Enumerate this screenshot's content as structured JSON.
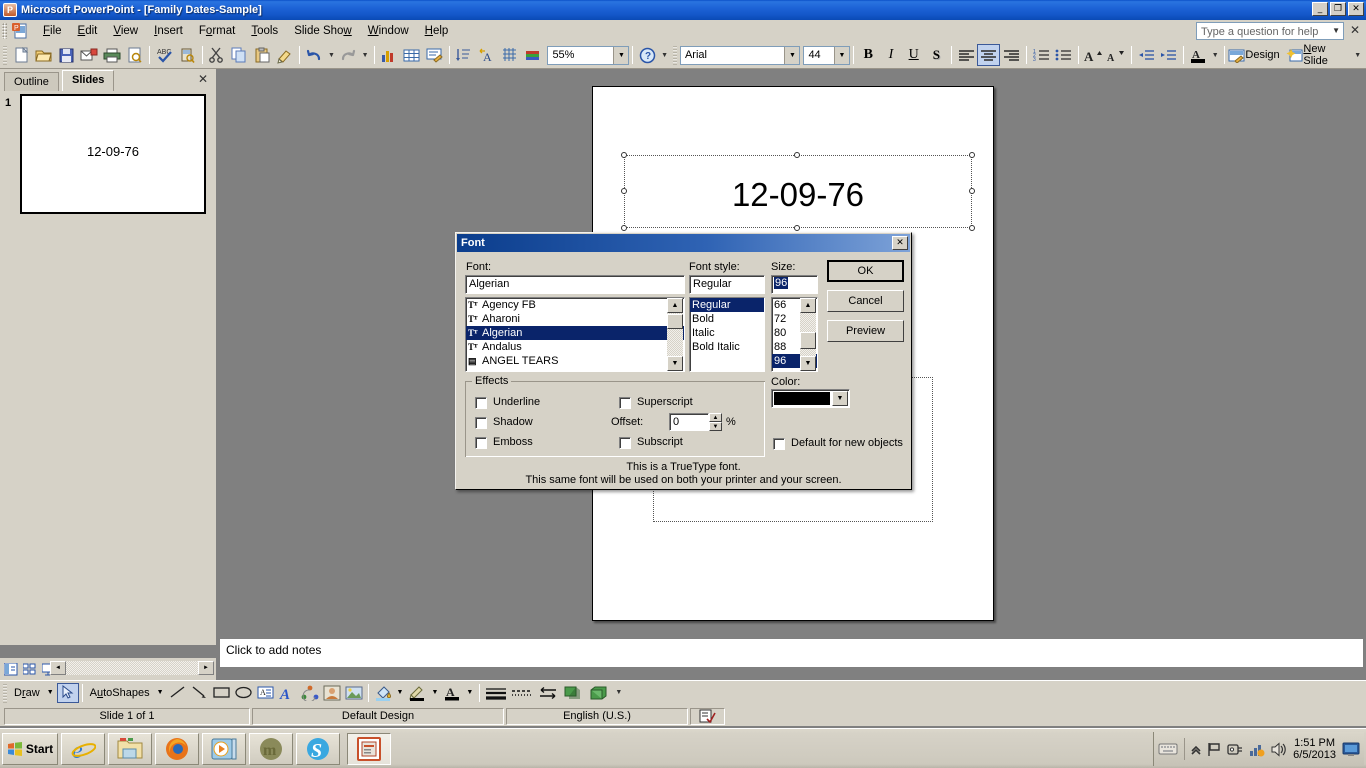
{
  "titlebar": {
    "title": "Microsoft PowerPoint - [Family Dates-Sample]",
    "app_icon": "powerpoint-icon",
    "minimize": "_",
    "restore": "❐",
    "close": "✕"
  },
  "menubar": {
    "items": [
      "File",
      "Edit",
      "View",
      "Insert",
      "Format",
      "Tools",
      "Slide Show",
      "Window",
      "Help"
    ],
    "help_box_placeholder": "Type a question for help",
    "help_close": "✕"
  },
  "toolbar": {
    "zoom_value": "55%",
    "font_name": "Arial",
    "font_size": "44",
    "bold": "B",
    "italic": "I",
    "underline": "U",
    "shadow": "S",
    "design_label": "Design",
    "new_slide_label": "New Slide",
    "icons": [
      "new-document-icon",
      "open-folder-icon",
      "save-icon",
      "email-icon",
      "print-icon",
      "print-preview-icon",
      "spelling-icon",
      "research-icon",
      "cut-icon",
      "copy-icon",
      "paste-icon",
      "format-painter-icon",
      "undo-icon",
      "redo-icon",
      "insert-chart-icon",
      "insert-table-icon",
      "insert-diagram-icon",
      "sort-icon",
      "animation-icon",
      "show-grid-icon",
      "color-scheme-icon",
      "zoom-combo",
      "help-icon"
    ]
  },
  "leftpane": {
    "tabs": [
      {
        "label": "Outline",
        "selected": false
      },
      {
        "label": "Slides",
        "selected": true
      }
    ],
    "close": "✕",
    "slide_number": "1",
    "thumb_text": "12-09-76"
  },
  "slide": {
    "title_text": "12-09-76"
  },
  "notes": {
    "placeholder": "Click to add notes"
  },
  "drawbar": {
    "draw_label": "Draw",
    "autoshapes_label": "AutoShapes",
    "icons": [
      "select-arrow-icon",
      "line-icon",
      "arrow-icon",
      "rectangle-icon",
      "oval-icon",
      "text-box-icon",
      "wordart-icon",
      "diagram-icon",
      "clipart-icon",
      "picture-icon",
      "fill-color-icon",
      "line-color-icon",
      "font-color-icon",
      "line-style-icon",
      "dash-style-icon",
      "arrow-style-icon",
      "shadow-style-icon",
      "3d-style-icon"
    ]
  },
  "statusbar": {
    "slide_info": "Slide 1 of 1",
    "design": "Default Design",
    "language": "English (U.S.)",
    "spellcheck_icon": "spellcheck-icon"
  },
  "taskbar": {
    "start_label": "Start",
    "quicklaunch": [
      "internet-explorer-icon",
      "windows-explorer-icon",
      "firefox-icon",
      "media-player-icon",
      "mozilla-icon",
      "skype-icon"
    ],
    "active_task": "powerpoint-taskbar-icon",
    "tray_icons": [
      "keyboard-icon",
      "show-hidden-icon",
      "flag-icon",
      "safely-remove-icon",
      "network-icon",
      "volume-icon"
    ],
    "time": "1:51 PM",
    "date": "6/5/2013",
    "show-desktop": "show-desktop-icon"
  },
  "dialog": {
    "title": "Font",
    "close": "✕",
    "font_label": "Font:",
    "font_value": "Algerian",
    "font_list": [
      {
        "name": "Agency FB",
        "type": "truetype",
        "selected": false
      },
      {
        "name": "Aharoni",
        "type": "truetype",
        "selected": false
      },
      {
        "name": "Algerian",
        "type": "truetype",
        "selected": true
      },
      {
        "name": "Andalus",
        "type": "truetype",
        "selected": false
      },
      {
        "name": "ANGEL TEARS",
        "type": "printer",
        "selected": false
      }
    ],
    "style_label": "Font style:",
    "style_value": "Regular",
    "style_list": [
      {
        "name": "Regular",
        "selected": true
      },
      {
        "name": "Bold",
        "selected": false
      },
      {
        "name": "Italic",
        "selected": false
      },
      {
        "name": "Bold Italic",
        "selected": false
      }
    ],
    "size_label": "Size:",
    "size_value": "96",
    "size_list": [
      {
        "name": "66",
        "selected": false
      },
      {
        "name": "72",
        "selected": false
      },
      {
        "name": "80",
        "selected": false
      },
      {
        "name": "88",
        "selected": false
      },
      {
        "name": "96",
        "selected": true
      }
    ],
    "buttons": {
      "ok": "OK",
      "cancel": "Cancel",
      "preview": "Preview"
    },
    "effects_label": "Effects",
    "effects": [
      {
        "label": "Underline",
        "checked": false
      },
      {
        "label": "Shadow",
        "checked": false
      },
      {
        "label": "Emboss",
        "checked": false
      },
      {
        "label": "Superscript",
        "checked": false
      },
      {
        "label": "Subscript",
        "checked": false
      }
    ],
    "offset_label": "Offset:",
    "offset_value": "0",
    "offset_unit": "%",
    "color_label": "Color:",
    "color_value": "#000000",
    "default_checkbox": {
      "label": "Default for new objects",
      "checked": false
    },
    "note_line1": "This is a TrueType font.",
    "note_line2": "This same font will be used on both your printer and your screen."
  },
  "colors": {
    "titlebar_blue": "#0a50c8",
    "dialog_face": "#d6d2c7",
    "selection_navy": "#0a246a",
    "desktop_gray": "#808080"
  }
}
